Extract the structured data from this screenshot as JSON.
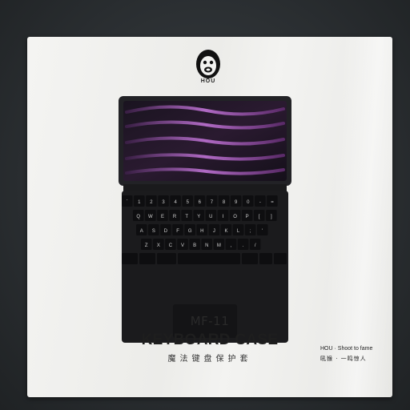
{
  "box": {
    "brand": "HOU",
    "model": "MF-11",
    "product_name": "KEYBOARD CASE",
    "product_name_cn": "魔法键盘保护套",
    "tagline_en": "HOU · Shoot to fame",
    "tagline_cn": "吼猴 · 一鸣惊人"
  },
  "keyboard": {
    "row_number": [
      "`",
      "1",
      "2",
      "3",
      "4",
      "5",
      "6",
      "7",
      "8",
      "9",
      "0",
      "-",
      "="
    ],
    "row_top": [
      "Q",
      "W",
      "E",
      "R",
      "T",
      "Y",
      "U",
      "I",
      "O",
      "P",
      "[",
      "]"
    ],
    "row_home": [
      "A",
      "S",
      "D",
      "F",
      "G",
      "H",
      "J",
      "K",
      "L",
      ";",
      "'"
    ],
    "row_bottom": [
      "Z",
      "X",
      "C",
      "V",
      "B",
      "N",
      "M",
      ",",
      ".",
      "/"
    ]
  },
  "colors": {
    "box": "#f0f0ee",
    "background": "#2c3033",
    "keyboard": "#1b1b1d",
    "screen_accent": "#8a4fa0"
  },
  "icons": [
    "monkey-logo-icon"
  ]
}
